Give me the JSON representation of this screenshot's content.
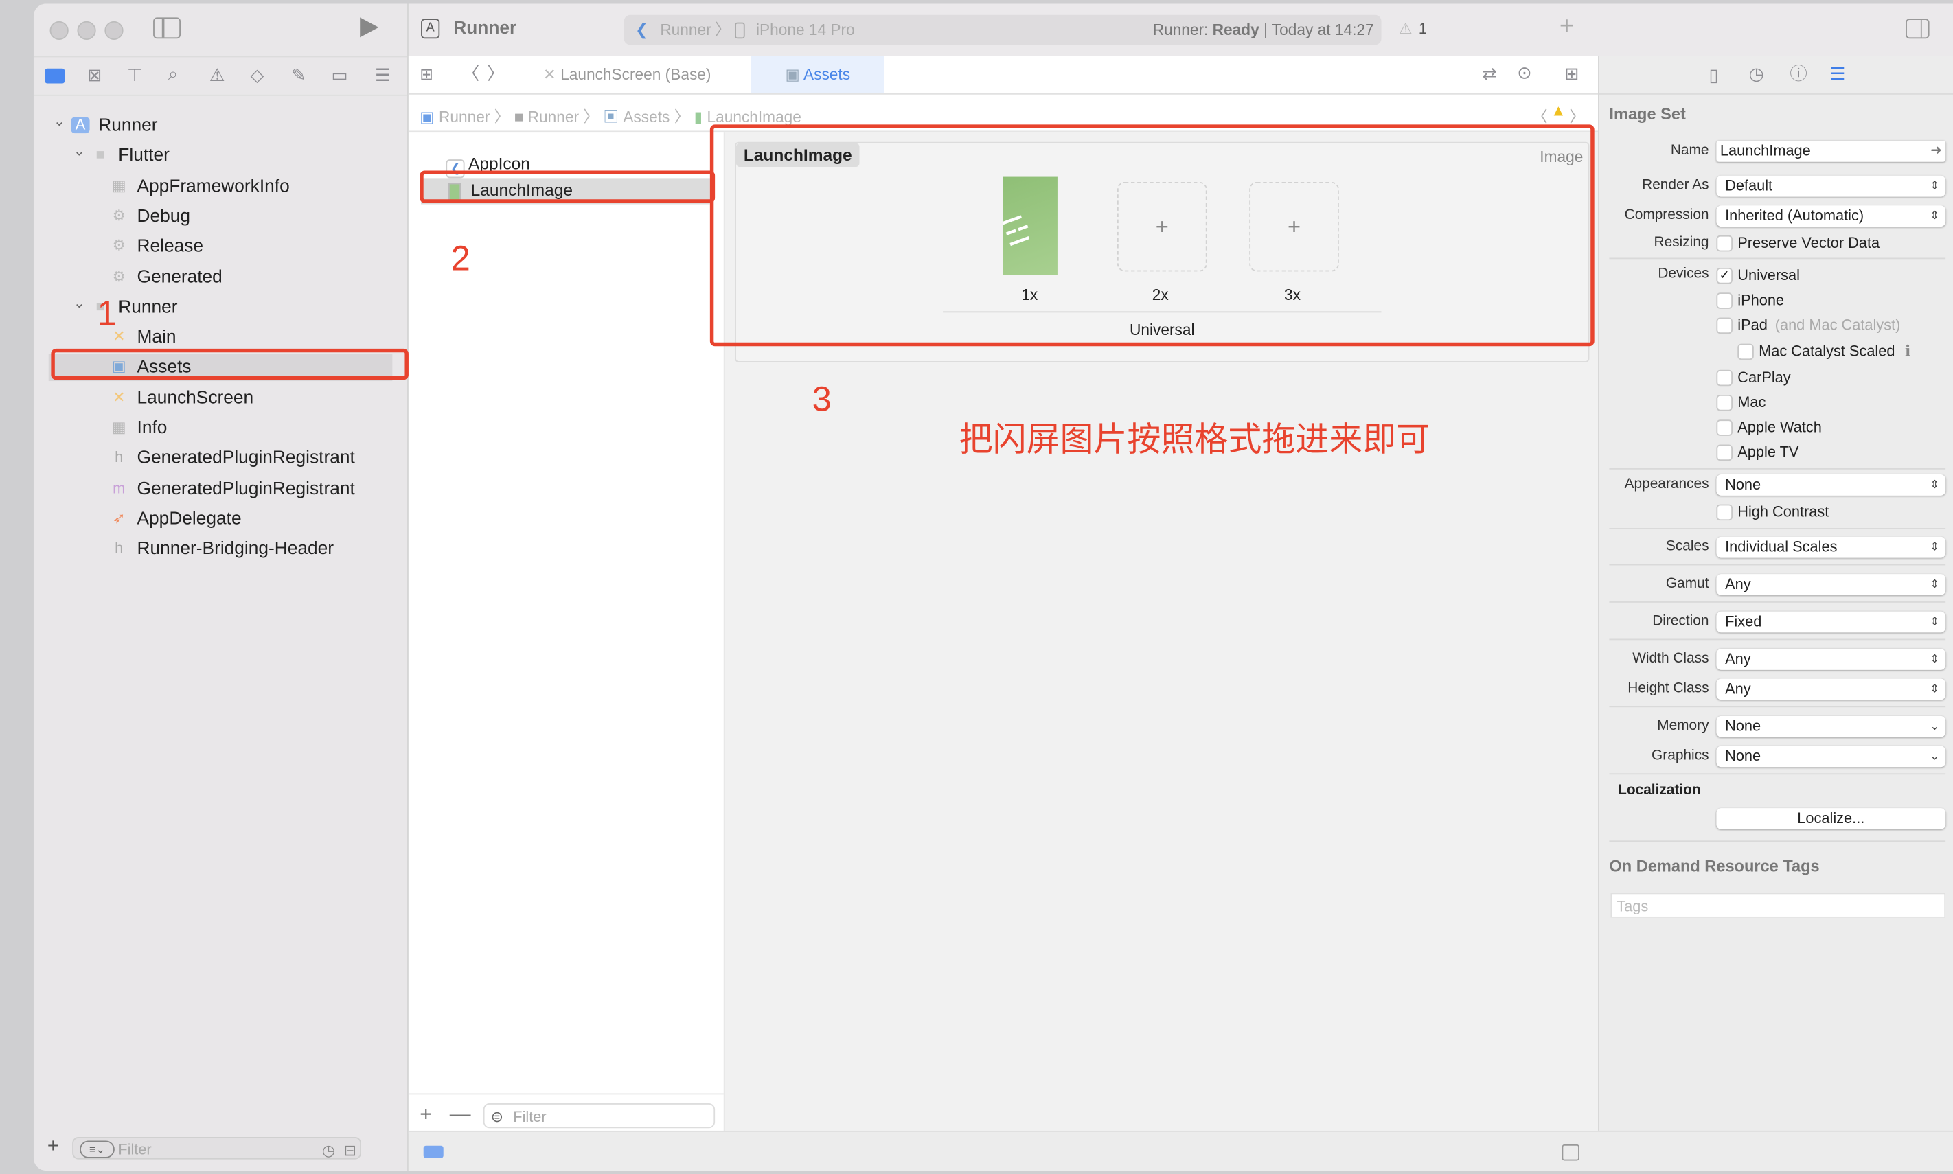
{
  "toolbar": {
    "project": "Runner",
    "scheme": "Runner",
    "device": "iPhone 14 Pro",
    "status_prefix": "Runner: ",
    "status_state": "Ready",
    "status_time": "| Today at 14:27",
    "warning_count": "1"
  },
  "tabs": [
    {
      "label": "LaunchScreen (Base)",
      "active": false
    },
    {
      "label": "Assets",
      "active": true
    }
  ],
  "breadcrumb": [
    "Runner",
    "Runner",
    "Assets",
    "LaunchImage"
  ],
  "navigator": {
    "items": [
      {
        "label": "Runner",
        "level": 0,
        "icon": "app-project-icon",
        "expanded": true
      },
      {
        "label": "Flutter",
        "level": 1,
        "icon": "folder-icon",
        "expanded": true
      },
      {
        "label": "AppFrameworkInfo",
        "level": 2,
        "icon": "plist-icon"
      },
      {
        "label": "Debug",
        "level": 2,
        "icon": "xcconfig-icon"
      },
      {
        "label": "Release",
        "level": 2,
        "icon": "xcconfig-icon"
      },
      {
        "label": "Generated",
        "level": 2,
        "icon": "xcconfig-icon"
      },
      {
        "label": "Runner",
        "level": 1,
        "icon": "folder-icon",
        "expanded": true
      },
      {
        "label": "Main",
        "level": 2,
        "icon": "storyboard-icon"
      },
      {
        "label": "Assets",
        "level": 2,
        "icon": "asset-catalog-icon",
        "selected": true
      },
      {
        "label": "LaunchScreen",
        "level": 2,
        "icon": "storyboard-icon"
      },
      {
        "label": "Info",
        "level": 2,
        "icon": "plist-icon"
      },
      {
        "label": "GeneratedPluginRegistrant",
        "level": 2,
        "icon": "header-icon"
      },
      {
        "label": "GeneratedPluginRegistrant",
        "level": 2,
        "icon": "objc-icon"
      },
      {
        "label": "AppDelegate",
        "level": 2,
        "icon": "swift-icon"
      },
      {
        "label": "Runner-Bridging-Header",
        "level": 2,
        "icon": "header-icon"
      }
    ],
    "filter_placeholder": "Filter"
  },
  "asset_list": {
    "items": [
      {
        "label": "AppIcon",
        "selected": false
      },
      {
        "label": "LaunchImage",
        "selected": true
      }
    ],
    "filter_placeholder": "Filter"
  },
  "asset_set": {
    "name": "LaunchImage",
    "type": "Image",
    "slots": [
      "1x",
      "2x",
      "3x"
    ],
    "group_label": "Universal"
  },
  "annotations": {
    "num1": "1",
    "num2": "2",
    "num3": "3",
    "note": "把闪屏图片按照格式拖进来即可",
    "color": "#e8432e"
  },
  "inspector": {
    "title": "Image Set",
    "name_label": "Name",
    "name_value": "LaunchImage",
    "render_label": "Render As",
    "render_value": "Default",
    "compression_label": "Compression",
    "compression_value": "Inherited (Automatic)",
    "resizing_label": "Resizing",
    "resizing_option": "Preserve Vector Data",
    "devices_label": "Devices",
    "devices": [
      {
        "label": "Universal",
        "checked": true
      },
      {
        "label": "iPhone",
        "checked": false
      },
      {
        "label": "iPad",
        "note": "(and Mac Catalyst)",
        "checked": false
      },
      {
        "label": "Mac Catalyst Scaled",
        "checked": false
      },
      {
        "label": "CarPlay",
        "checked": false
      },
      {
        "label": "Mac",
        "checked": false
      },
      {
        "label": "Apple Watch",
        "checked": false
      },
      {
        "label": "Apple TV",
        "checked": false
      }
    ],
    "appearances_label": "Appearances",
    "appearances_value": "None",
    "high_contrast": "High Contrast",
    "scales_label": "Scales",
    "scales_value": "Individual Scales",
    "gamut_label": "Gamut",
    "gamut_value": "Any",
    "direction_label": "Direction",
    "direction_value": "Fixed",
    "width_label": "Width Class",
    "width_value": "Any",
    "height_label": "Height Class",
    "height_value": "Any",
    "memory_label": "Memory",
    "memory_value": "None",
    "graphics_label": "Graphics",
    "graphics_value": "None",
    "localization_title": "Localization",
    "localize_button": "Localize...",
    "odr_title": "On Demand Resource Tags",
    "tags_placeholder": "Tags"
  }
}
